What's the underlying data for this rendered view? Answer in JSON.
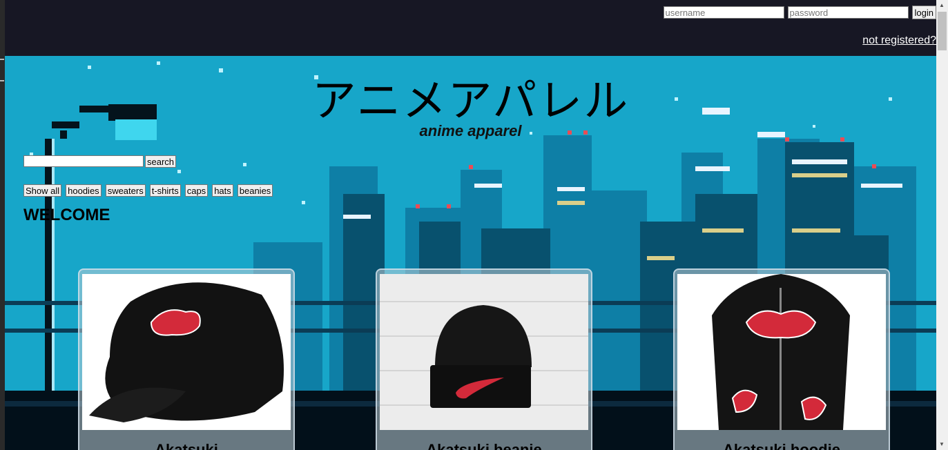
{
  "header": {
    "username_placeholder": "username",
    "password_placeholder": "password",
    "login_label": "login",
    "register_link": "not registered?"
  },
  "hero": {
    "title": "アニメアパレル",
    "subtitle": "anime apparel"
  },
  "search": {
    "value": "",
    "button_label": "search"
  },
  "categories": [
    "Show all",
    "hoodies",
    "sweaters",
    "t-shirts",
    "caps",
    "hats",
    "beanies"
  ],
  "welcome": "WELCOME",
  "products": [
    {
      "name": "Akatsuki",
      "image": "black-cap-red-cloud"
    },
    {
      "name": "Akatsuki beanie",
      "image": "black-beanie-red-swoosh"
    },
    {
      "name": "Akatsuki hoodie",
      "image": "black-hoodie-red-clouds"
    }
  ],
  "colors": {
    "topbar": "#171724",
    "sky": "#17a6c9",
    "accent_red": "#d32a3a"
  }
}
